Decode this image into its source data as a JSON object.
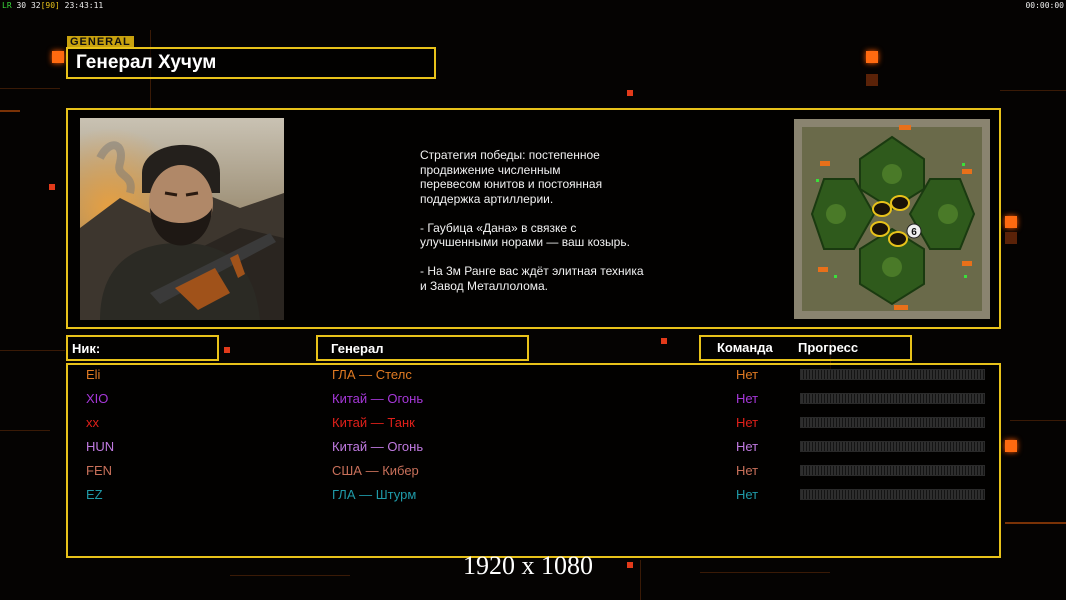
{
  "hud": {
    "left_prefix": "LR",
    "left_a": "30",
    "left_b": "32",
    "left_c": "[90]",
    "left_time": "23:43:11",
    "right_time": "00:00:00"
  },
  "header": {
    "tag": "GENERAL",
    "name": "Генерал Хучум"
  },
  "description": "Стратегия победы: постепенное\nпродвижение численным\nперевесом юнитов и постоянная\nподдержка артиллерии.\n\n- Гаубица «Дана» в связке с\nулучшенными норами — ваш козырь.\n\n- На 3м Ранге вас ждёт элитная техника\nи Завод Металлолома.",
  "minimap": {
    "marker_label": "6"
  },
  "columns": {
    "nick": "Ник:",
    "general": "Генерал",
    "team": "Команда",
    "progress": "Прогресс"
  },
  "players": [
    {
      "nick": "Eli",
      "general": "ГЛА — Стелс",
      "team": "Нет",
      "progress": 0,
      "color": "#e07a22"
    },
    {
      "nick": "XIO",
      "general": "Китай — Огонь",
      "team": "Нет",
      "progress": 0,
      "color": "#a638d8"
    },
    {
      "nick": "xx",
      "general": "Китай — Танк",
      "team": "Нет",
      "progress": 0,
      "color": "#e0201a"
    },
    {
      "nick": "HUN",
      "general": "Китай — Огонь",
      "team": "Нет",
      "progress": 0,
      "color": "#c07ae0"
    },
    {
      "nick": "FEN",
      "general": "США — Кибер",
      "team": "Нет",
      "progress": 0,
      "color": "#c8705a"
    },
    {
      "nick": "EZ",
      "general": "ГЛА — Штурм",
      "team": "Нет",
      "progress": 0,
      "color": "#1f9aa8"
    }
  ],
  "footer": {
    "resolution": "1920 x 1080"
  },
  "colors": {
    "accent": "#e8c21a",
    "orange": "#ff6a10"
  }
}
